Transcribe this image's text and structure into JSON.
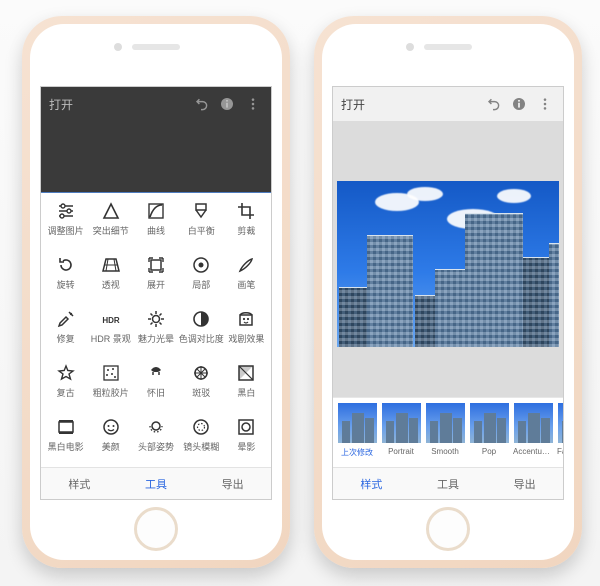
{
  "left": {
    "header": {
      "open_label": "打开"
    },
    "tools": [
      {
        "key": "tune",
        "label": "调整图片"
      },
      {
        "key": "details",
        "label": "突出细节"
      },
      {
        "key": "curves",
        "label": "曲线"
      },
      {
        "key": "whitebal",
        "label": "白平衡"
      },
      {
        "key": "crop",
        "label": "剪裁"
      },
      {
        "key": "rotate",
        "label": "旋转"
      },
      {
        "key": "perspective",
        "label": "透视"
      },
      {
        "key": "expand",
        "label": "展开"
      },
      {
        "key": "selective",
        "label": "局部"
      },
      {
        "key": "brush",
        "label": "画笔"
      },
      {
        "key": "healing",
        "label": "修复"
      },
      {
        "key": "hdr",
        "label": "HDR 景观"
      },
      {
        "key": "glamour",
        "label": "魅力光晕"
      },
      {
        "key": "tonal",
        "label": "色调对比度"
      },
      {
        "key": "drama",
        "label": "戏剧效果"
      },
      {
        "key": "vintage",
        "label": "复古"
      },
      {
        "key": "grainy",
        "label": "粗粒胶片"
      },
      {
        "key": "retrolux",
        "label": "怀旧"
      },
      {
        "key": "grunge",
        "label": "斑驳"
      },
      {
        "key": "bw",
        "label": "黑白"
      },
      {
        "key": "noir",
        "label": "黑白电影"
      },
      {
        "key": "portrait",
        "label": "美颜"
      },
      {
        "key": "headpose",
        "label": "头部姿势"
      },
      {
        "key": "lensblur",
        "label": "镜头模糊"
      },
      {
        "key": "vignette",
        "label": "晕影"
      }
    ],
    "tabs": {
      "styles": "样式",
      "tools": "工具",
      "export": "导出",
      "active": "tools"
    }
  },
  "right": {
    "header": {
      "open_label": "打开"
    },
    "styles": [
      {
        "key": "last",
        "label": "上次修改"
      },
      {
        "key": "portrait",
        "label": "Portrait"
      },
      {
        "key": "smooth",
        "label": "Smooth"
      },
      {
        "key": "pop",
        "label": "Pop"
      },
      {
        "key": "accentuate",
        "label": "Accentuate"
      },
      {
        "key": "faded",
        "label": "Faded Glow"
      }
    ],
    "tabs": {
      "styles": "样式",
      "tools": "工具",
      "export": "导出",
      "active": "styles"
    }
  }
}
